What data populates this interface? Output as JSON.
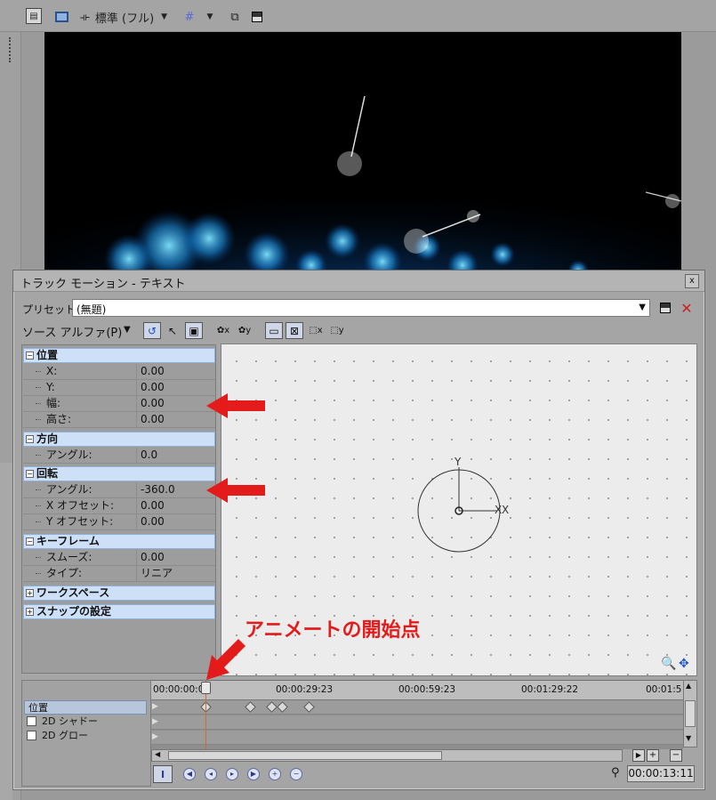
{
  "preview": {
    "quality_label": "標準 (フル)"
  },
  "dialog": {
    "title": "トラック モーション - テキスト",
    "close_label": "x",
    "preset_label": "プリセット:",
    "preset_value": "(無題)",
    "source_alpha_label": "ソース アルファ(P)"
  },
  "properties": {
    "position": {
      "header": "位置",
      "rows": [
        {
          "label": "X:",
          "value": "0.00"
        },
        {
          "label": "Y:",
          "value": "0.00"
        },
        {
          "label": "幅:",
          "value": "0.00"
        },
        {
          "label": "高さ:",
          "value": "0.00"
        }
      ]
    },
    "orientation": {
      "header": "方向",
      "rows": [
        {
          "label": "アングル:",
          "value": "0.0"
        }
      ]
    },
    "rotation": {
      "header": "回転",
      "rows": [
        {
          "label": "アングル:",
          "value": "-360.0"
        },
        {
          "label": "X オフセット:",
          "value": "0.00"
        },
        {
          "label": "Y オフセット:",
          "value": "0.00"
        }
      ]
    },
    "keyframe": {
      "header": "キーフレーム",
      "rows": [
        {
          "label": "スムーズ:",
          "value": "0.00"
        },
        {
          "label": "タイプ:",
          "value": "リニア"
        }
      ]
    },
    "workspace_header": "ワークスペース",
    "snap_header": "スナップの設定"
  },
  "canvas": {
    "y_label": "Y",
    "x_label": "X"
  },
  "timeline": {
    "tracks": [
      "位置",
      "2D シャドー",
      "2D グロー"
    ],
    "ruler": [
      "00:00:00:00",
      "00:00:29:23",
      "00:00:59:23",
      "00:01:29:22",
      "00:01:5"
    ],
    "current_time": "00:00:13:11"
  },
  "annotation": {
    "text": "アニメートの開始点",
    "color": "#e41b1b"
  },
  "colors": {
    "section_header": "#cde0f7",
    "workspace_bg": "#ececec",
    "cursor": "#d06a3a"
  }
}
